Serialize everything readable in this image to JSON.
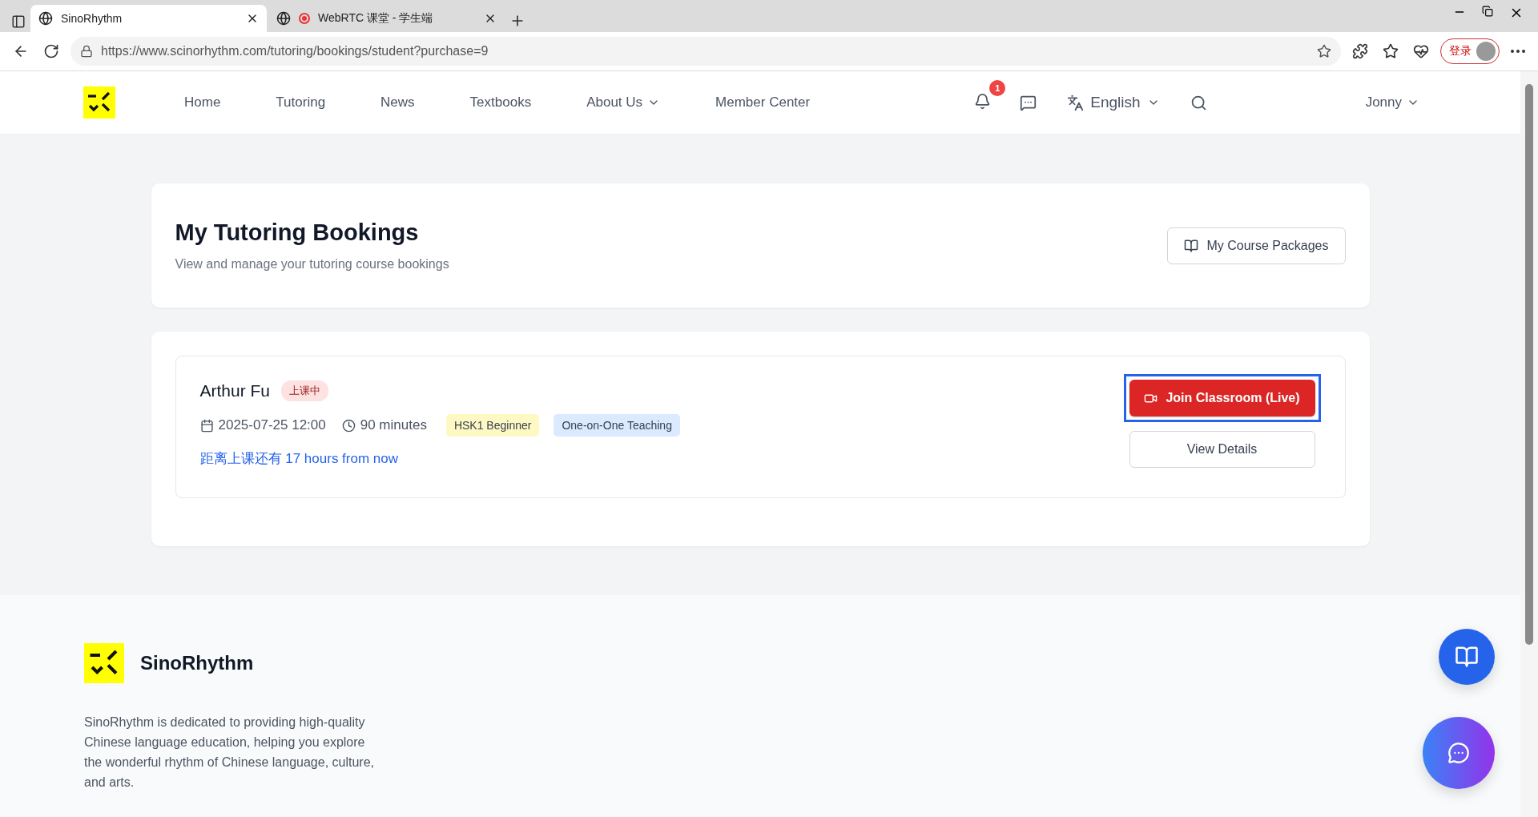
{
  "browser": {
    "tabs": [
      {
        "title": "SinoRhythm",
        "kind": "site",
        "selected": true
      },
      {
        "title": "WebRTC 课堂 - 学生端",
        "kind": "recording",
        "selected": false
      }
    ],
    "url": "https://www.scinorhythm.com/tutoring/bookings/student?purchase=9",
    "profile_label": "登录"
  },
  "nav": {
    "items": [
      {
        "label": "Home",
        "dropdown": false
      },
      {
        "label": "Tutoring",
        "dropdown": false
      },
      {
        "label": "News",
        "dropdown": false
      },
      {
        "label": "Textbooks",
        "dropdown": false
      },
      {
        "label": "About Us",
        "dropdown": true
      },
      {
        "label": "Member Center",
        "dropdown": false
      }
    ],
    "notification_count": "1",
    "language": "English",
    "user": "Jonny"
  },
  "header": {
    "title": "My Tutoring Bookings",
    "subtitle": "View and manage your tutoring course bookings",
    "button": "My Course Packages"
  },
  "bookings": [
    {
      "teacher": "Arthur Fu",
      "status": "上课中",
      "date": "2025-07-25 12:00",
      "duration": "90 minutes",
      "tags": [
        {
          "label": "HSK1 Beginner",
          "color": "#fef9c3"
        },
        {
          "label": "One-on-One Teaching",
          "color": "#dbeafe"
        }
      ],
      "countdown": "距离上课还有 17 hours from now",
      "actions": [
        {
          "label": "Join Classroom (Live)",
          "kind": "primary",
          "focused": true
        },
        {
          "label": "View Details",
          "kind": "secondary",
          "focused": false
        }
      ]
    }
  ],
  "footer": {
    "brand": "SinoRhythm",
    "description": "SinoRhythm is dedicated to providing high-quality Chinese language education, helping you explore the wonderful rhythm of Chinese language, culture, and arts."
  }
}
